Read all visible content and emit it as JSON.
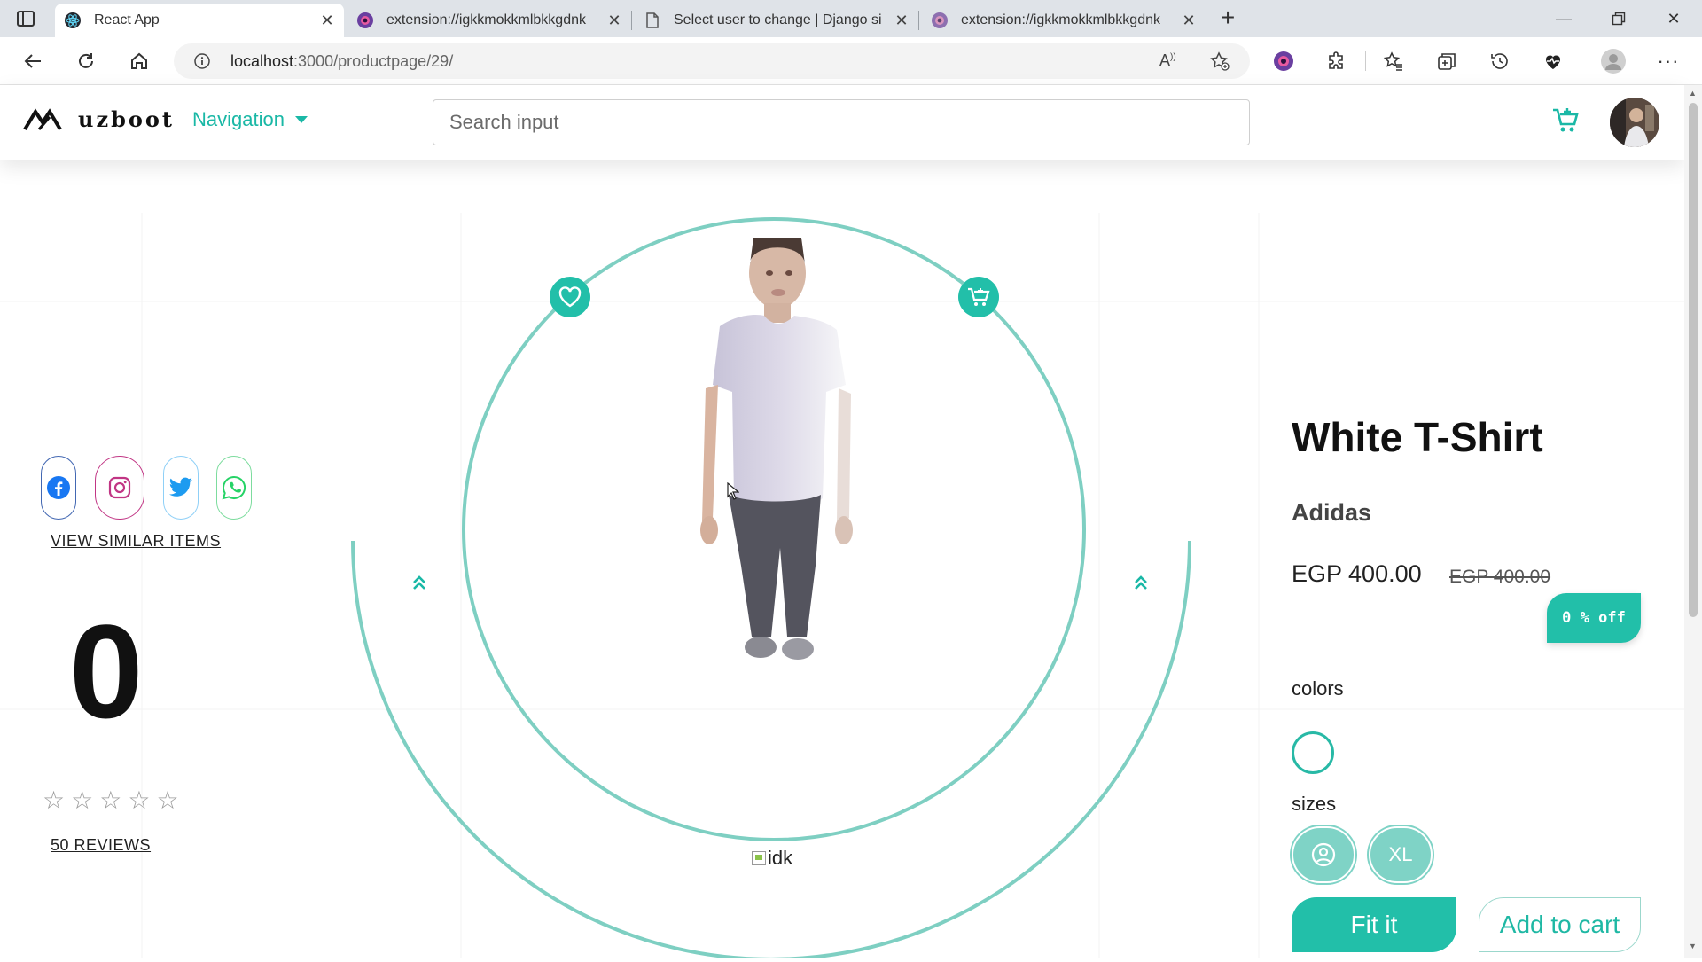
{
  "browser": {
    "tabs": [
      {
        "label": "React App",
        "active": true
      },
      {
        "label": "extension://igkkmokkmlbkkgdnk"
      },
      {
        "label": "Select user to change | Django si"
      },
      {
        "label": "extension://igkkmokkmlbkkgdnk"
      }
    ],
    "url_host": "localhost",
    "url_path": ":3000/productpage/29/"
  },
  "header": {
    "brand": "uzboot",
    "nav_label": "Navigation",
    "search_placeholder": "Search input"
  },
  "left": {
    "social_icons": [
      "facebook-icon",
      "instagram-icon",
      "twitter-icon",
      "whatsapp-icon"
    ],
    "similar_link": "VIEW SIMILAR ITEMS",
    "count": "0",
    "rating": 0,
    "max_rating": 5,
    "reviews_link": "50 REVIEWS"
  },
  "stage": {
    "broken_image_alt": "idk"
  },
  "product": {
    "title": "White T-Shirt",
    "brand": "Adidas",
    "price": "EGP 400.00",
    "old_price": "EGP 400.00",
    "discount_badge": "0 % off",
    "colors_label": "colors",
    "sizes_label": "sizes",
    "size_xl": "XL",
    "fit_button": "Fit it",
    "add_to_cart_button": "Add to cart"
  },
  "colors": {
    "accent": "#22bfa9",
    "ring": "#7ecfc2"
  }
}
